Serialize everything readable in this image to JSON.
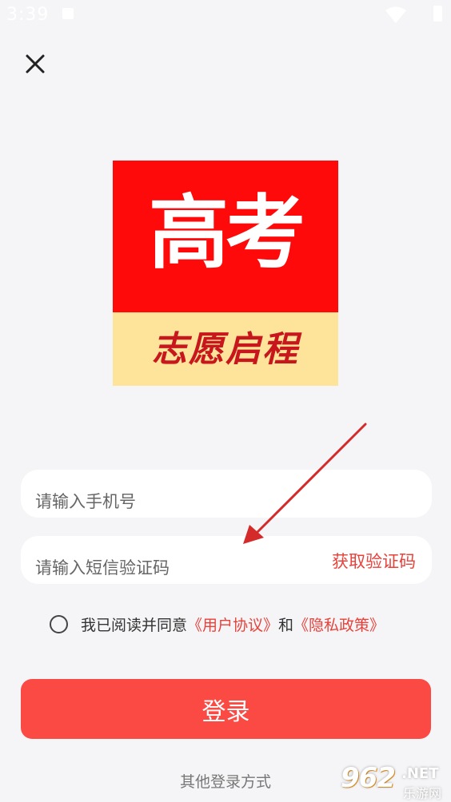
{
  "status_bar": {
    "time": "3:39",
    "icons": [
      "notification-icon",
      "wifi-icon",
      "battery-icon"
    ]
  },
  "header": {
    "close_icon": "close-icon"
  },
  "logo": {
    "title": "高考",
    "subtitle": "志愿启程"
  },
  "form": {
    "phone_placeholder": "请输入手机号",
    "phone_value": "",
    "code_placeholder": "请输入短信验证码",
    "code_value": "",
    "get_code_label": "获取验证码"
  },
  "agreement": {
    "checked": false,
    "prefix": "我已阅读并同意",
    "user_agreement": "《用户协议》",
    "conjunction": "和",
    "privacy_policy": "《隐私政策》"
  },
  "login_button": "登录",
  "other_login": "其他登录方式",
  "watermark": {
    "logo": "962",
    "net": ".NET",
    "cn": "乐游网"
  },
  "colors": {
    "accent": "#fb4944",
    "link": "#e8413a",
    "background": "#f5f5f7",
    "logo_red": "#ff0a0a",
    "logo_yellow": "#fee49b",
    "annotation_arrow": "#d42a2a"
  }
}
